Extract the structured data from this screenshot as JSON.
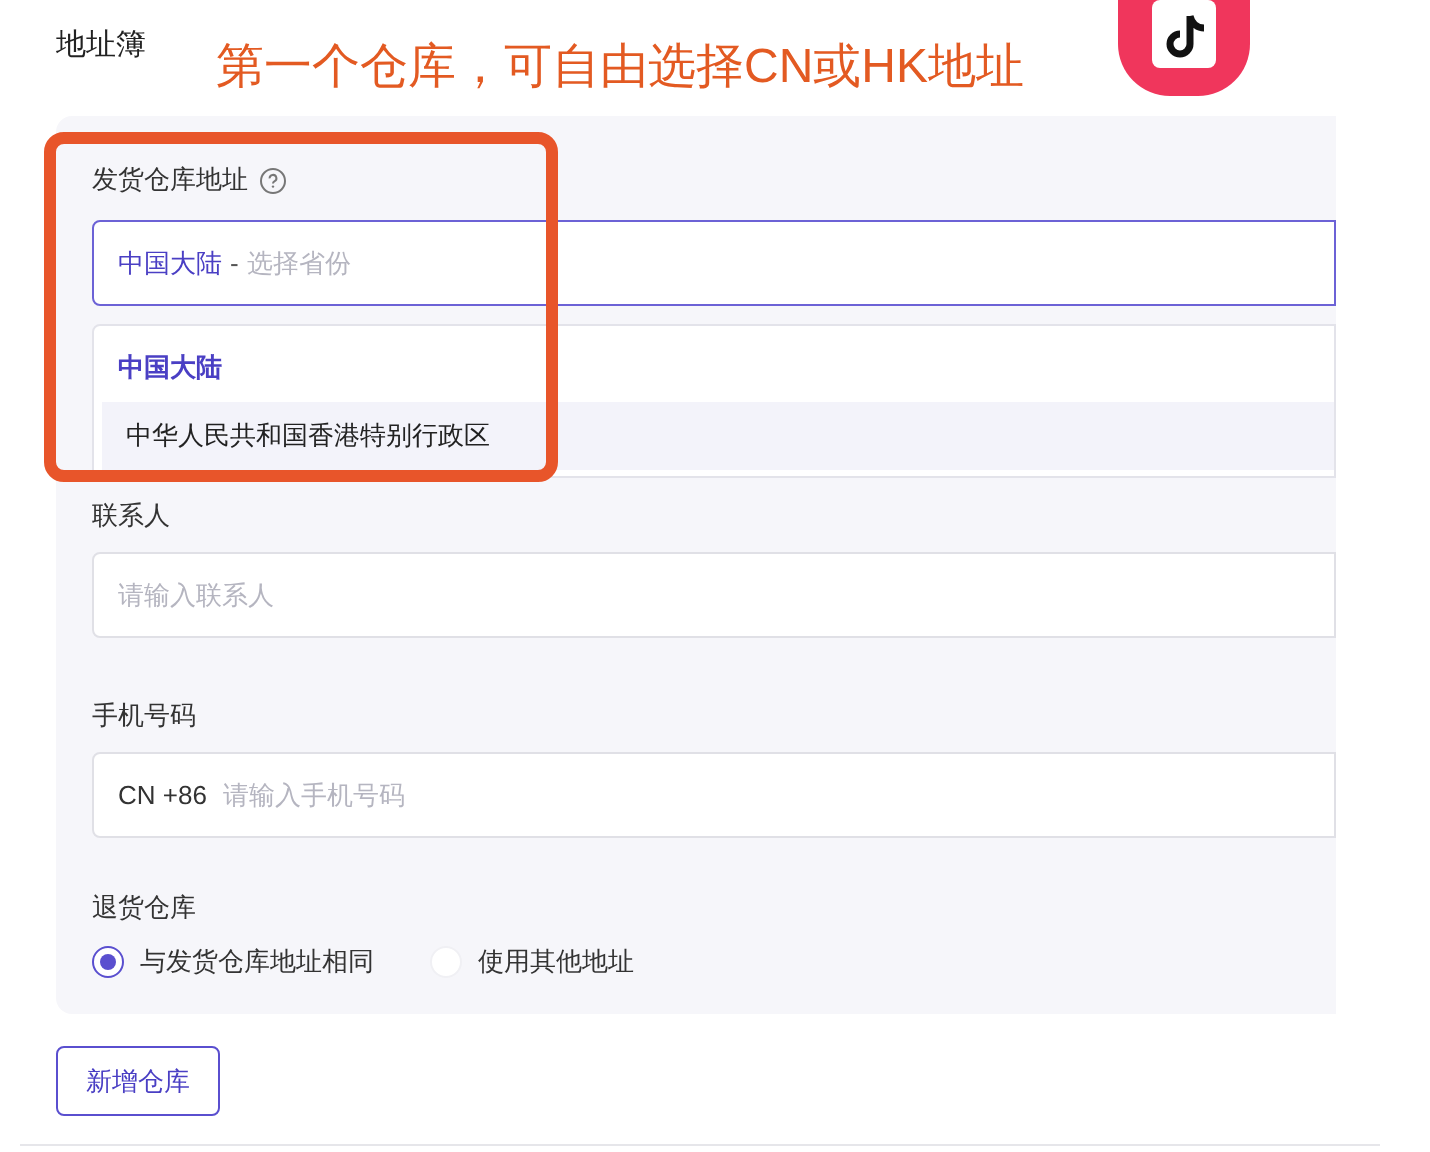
{
  "title": "地址簿",
  "annotation": {
    "text": "第一个仓库，可自由选择CN或HK地址"
  },
  "warehouse": {
    "label": "发货仓库地址",
    "region": "中国大陆",
    "separator": "-",
    "placeholder": "选择省份",
    "options": [
      {
        "label": "中国大陆",
        "selected": true
      },
      {
        "label": "中华人民共和国香港特别行政区",
        "selected": false
      }
    ]
  },
  "contact": {
    "label": "联系人",
    "placeholder": "请输入联系人"
  },
  "phone": {
    "label": "手机号码",
    "prefix": "CN +86",
    "placeholder": "请输入手机号码"
  },
  "return_warehouse": {
    "label": "退货仓库",
    "options": [
      {
        "label": "与发货仓库地址相同",
        "selected": true
      },
      {
        "label": "使用其他地址",
        "selected": false
      }
    ]
  },
  "add_button": "新增仓库"
}
